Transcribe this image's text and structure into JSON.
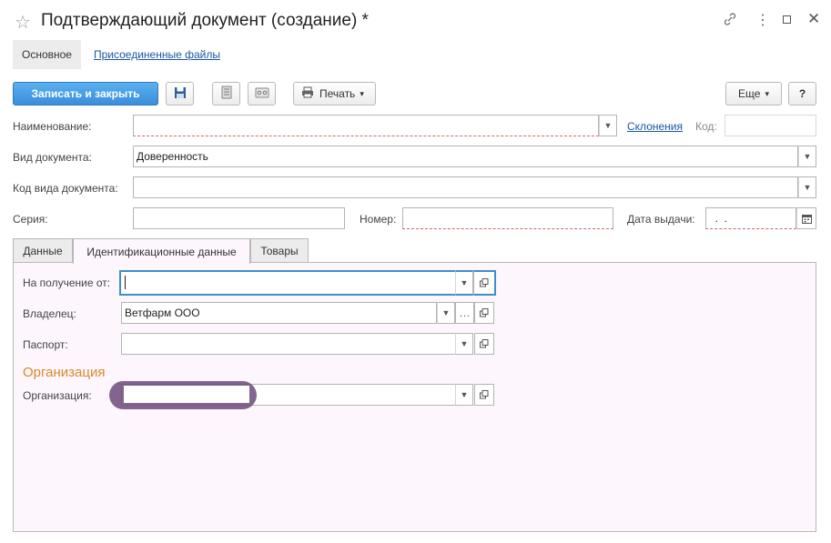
{
  "window": {
    "title": "Подтверждающий документ (создание) *"
  },
  "nav": {
    "tab_main": "Основное",
    "tab_files": "Присоединенные файлы"
  },
  "toolbar": {
    "save_close": "Записать и закрыть",
    "print": "Печать",
    "print_arrow": "▾",
    "more": "Еще",
    "more_arrow": "▾",
    "help": "?"
  },
  "form": {
    "name_label": "Наименование:",
    "name_value": "",
    "declensions_link": "Склонения",
    "code_label": "Код:",
    "code_value": "",
    "doc_type_label": "Вид документа:",
    "doc_type_value": "Доверенность",
    "doc_type_code_label": "Код вида документа:",
    "doc_type_code_value": "",
    "series_label": "Серия:",
    "series_value": "",
    "number_label": "Номер:",
    "number_value": "",
    "issue_date_label": "Дата выдачи:",
    "issue_date_value": "  .  ."
  },
  "tabs": {
    "data": "Данные",
    "ident": "Идентификационные данные",
    "goods": "Товары"
  },
  "ident": {
    "receive_from_label": "На получение от:",
    "receive_from_value": "",
    "owner_label": "Владелец:",
    "owner_value": "Ветфарм ООО",
    "passport_label": "Паспорт:",
    "passport_value": "",
    "org_section_title": "Организация",
    "org_label": "Организация:",
    "org_value": ""
  },
  "colors": {
    "primary_button": "#3a8edb",
    "link": "#1a57a0",
    "section_title": "#d88a2a",
    "tab_panel_bg": "#fdf6fd",
    "focus_border": "#3e8ecb"
  }
}
